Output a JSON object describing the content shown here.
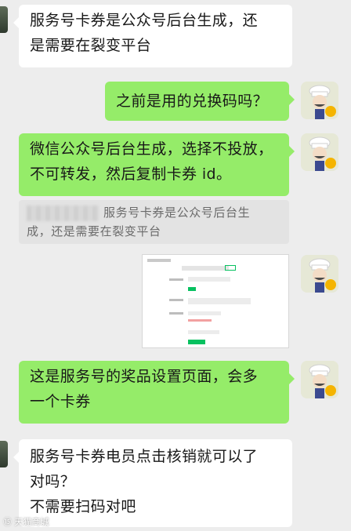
{
  "messages": [
    {
      "side": "left",
      "text": "服务号卡券是公众号后台生成，还\n是需要在裂变平台"
    },
    {
      "side": "right",
      "text": "之前是用的兑换码吗？"
    },
    {
      "side": "right",
      "text": "微信公众号后台生成，选择不投放，\n不可转发，然后复制卡券 id。"
    },
    {
      "side": "right",
      "type": "image",
      "image": {
        "description": "screenshot"
      }
    },
    {
      "side": "right",
      "text": "这是服务号的奖品设置页面，会多\n一个卡券"
    },
    {
      "side": "left",
      "text": "服务号卡券电员点击核销就可以了\n对吗？\n不需要扫码对吧"
    }
  ],
  "quote": {
    "text": "服务号卡券是公众号后台生\n成，还是需要在裂变平台"
  },
  "watermark": {
    "text": "⑮ 天猫商城"
  },
  "colors": {
    "background": "#ededed",
    "received_bubble": "#ffffff",
    "sent_bubble": "#95ec69",
    "badge": "#f5b400"
  },
  "icons": {
    "verified_badge": "check-badge-icon",
    "avatar": "chef-avatar"
  }
}
